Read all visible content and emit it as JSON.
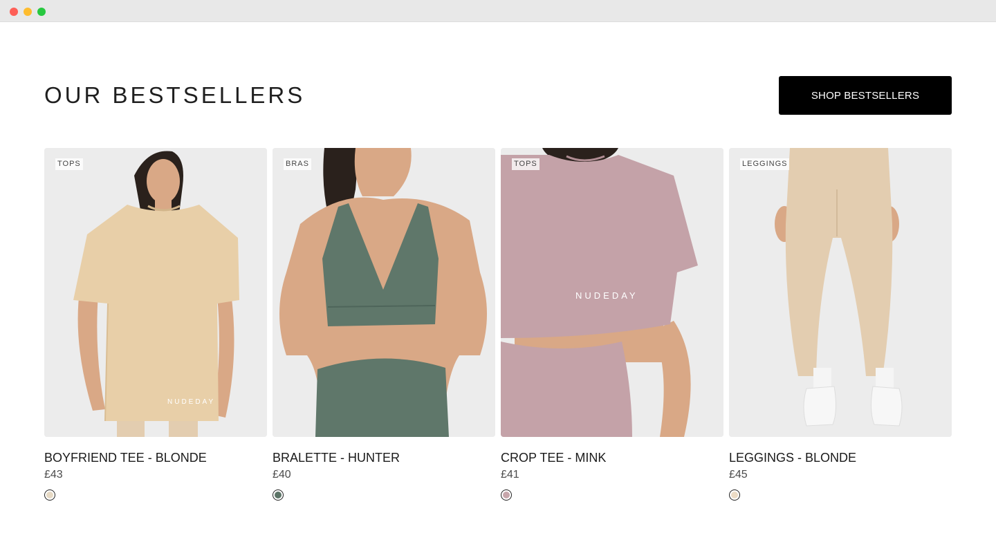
{
  "section": {
    "title": "OUR BESTSELLERS",
    "cta_label": "SHOP BESTSELLERS"
  },
  "products": [
    {
      "category": "TOPS",
      "name": "BOYFRIEND TEE - BLONDE",
      "price": "£43",
      "swatch_color": "#e6d9c4",
      "garment_color": "#e8cfa8",
      "logo": "NUDEDAY"
    },
    {
      "category": "BRAS",
      "name": "BRALETTE - HUNTER",
      "price": "£40",
      "swatch_color": "#5c7467",
      "garment_color": "#5f776a",
      "logo": ""
    },
    {
      "category": "TOPS",
      "name": "CROP TEE - MINK",
      "price": "£41",
      "swatch_color": "#c7a6ab",
      "garment_color": "#c4a2a8",
      "logo": "NUDEDAY"
    },
    {
      "category": "LEGGINGS",
      "name": "LEGGINGS - BLONDE",
      "price": "£45",
      "swatch_color": "#ecdcc6",
      "garment_color": "#e3cdb0",
      "logo": ""
    }
  ],
  "colors": {
    "skin": "#d9a886",
    "hair": "#2a211c",
    "photo_bg": "#ececec",
    "button_bg": "#000000"
  }
}
